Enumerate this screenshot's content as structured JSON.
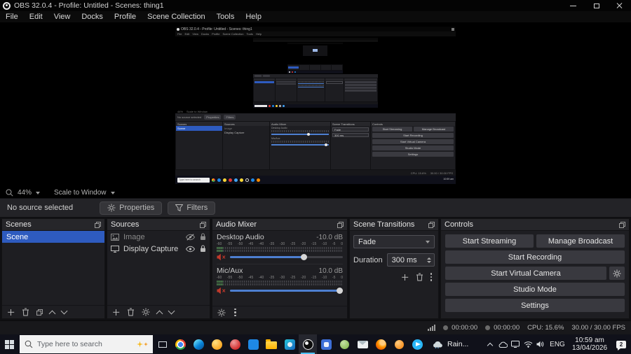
{
  "window": {
    "title": "OBS 32.0.4 - Profile: Untitled - Scenes: thing1"
  },
  "menu": {
    "items": [
      "File",
      "Edit",
      "View",
      "Docks",
      "Profile",
      "Scene Collection",
      "Tools",
      "Help"
    ]
  },
  "preview_toolbar": {
    "zoom": "44%",
    "scale_mode": "Scale to Window"
  },
  "source_toolbar": {
    "status": "No source selected",
    "properties_label": "Properties",
    "filters_label": "Filters"
  },
  "docks": {
    "scenes": {
      "title": "Scenes",
      "items": [
        "Scene"
      ]
    },
    "sources": {
      "title": "Sources",
      "items": [
        {
          "name": "Image",
          "visible": false,
          "locked": true
        },
        {
          "name": "Display Capture",
          "visible": true,
          "locked": true
        }
      ]
    },
    "mixer": {
      "title": "Audio Mixer",
      "scale_ticks": [
        "-60",
        "-55",
        "-50",
        "-45",
        "-40",
        "-35",
        "-30",
        "-25",
        "-20",
        "-15",
        "-10",
        "-5",
        "0"
      ],
      "channels": [
        {
          "name": "Desktop Audio",
          "level": "-10.0 dB"
        },
        {
          "name": "Mic/Aux",
          "level": "10.0 dB"
        }
      ]
    },
    "transitions": {
      "title": "Scene Transitions",
      "current": "Fade",
      "duration_label": "Duration",
      "duration_value": "300 ms"
    },
    "controls": {
      "title": "Controls",
      "start_streaming": "Start Streaming",
      "manage_broadcast": "Manage Broadcast",
      "start_recording": "Start Recording",
      "start_virtual_camera": "Start Virtual Camera",
      "studio_mode": "Studio Mode",
      "settings": "Settings"
    }
  },
  "status_bar": {
    "stream_time": "00:00:00",
    "recording_time": "00:00:00",
    "cpu": "CPU: 15.6%",
    "fps": "30.00 / 30.00 FPS"
  },
  "taskbar": {
    "search_placeholder": "Type here to search",
    "weather": "Rain...",
    "language": "ENG",
    "time": "10:59 am",
    "date": "13/04/2026",
    "notification_count": "2",
    "app_icons": [
      "windows-start",
      "chrome",
      "edge",
      "yellow-app",
      "red-app",
      "vscode",
      "file-explorer",
      "photos",
      "obs",
      "blue-app",
      "green-app",
      "mail",
      "firefox",
      "orange-app",
      "telegram"
    ],
    "tray_icons": [
      "tray-expand",
      "onedrive",
      "display",
      "network",
      "volume"
    ]
  },
  "colors": {
    "accent_blue": "#2e5bbf",
    "slider_blue": "#4d7fd0",
    "mute_red": "#c0392b",
    "taskbar_active_underline": "#4cc2ff"
  }
}
